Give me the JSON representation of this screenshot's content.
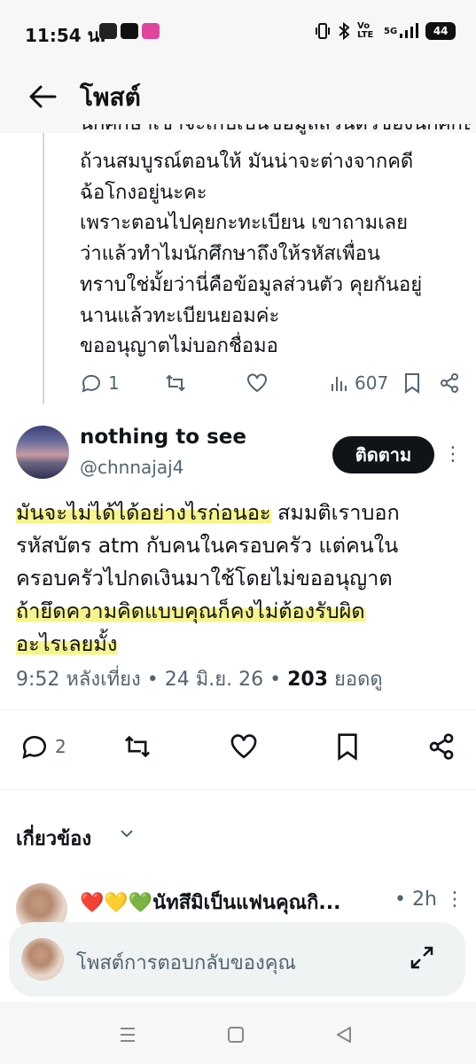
{
  "status_bar": {
    "time": "11:54 น.",
    "network": "5G",
    "volte": "Vo LTE",
    "battery": "44"
  },
  "header": {
    "title": "โพสต์"
  },
  "reply_post": {
    "lines": [
      "นักศึกษาเขาจะเก็บเป็นข้อมูลส่วนตัวของนักศึกษา",
      "ถ้วนสมบูรณ์ตอนให้ มันน่าจะต่างจากคดี",
      "ฉ้อโกงอยู่นะคะ",
      "เพราะตอนไปคุยกะทะเบียน เขาถามเลย",
      "ว่าแล้วทำไมนักศึกษาถึงให้รหัสเพื่อน",
      "ทราบใช่มั้ยว่านี่คือข้อมูลส่วนตัว คุยกันอยู่",
      "นานแล้วทะเบียนยอมค่ะ",
      "ขออนุญาตไม่บอกชื่อมอ"
    ],
    "replies": "1",
    "views": "607"
  },
  "main_post": {
    "author_name": "nothing to see",
    "author_handle": "@chnnajaj4",
    "follow_label": "ติดตาม",
    "text": {
      "l1_hl": "มันจะไม่ได้ได้อย่างไรก่อนอะ",
      "l1_rest": " สมมติเราบอก",
      "l2": "รหัสบัตร atm กับคนในครอบครัว แต่คนใน",
      "l3": "ครอบครัวไปกดเงินมาใช้โดยไม่ขออนุญาต",
      "l4_hl": "ถ้ายึดความคิดแบบคุณก็คงไม่ต้องรับผิด",
      "l5_hl": "อะไรเลยมั้ง"
    },
    "time": "9:52 หลังเที่ยง",
    "sep": " • ",
    "date": "24 มิ.ย. 26",
    "views": "203",
    "views_label": " ยอดดู",
    "replies": "2"
  },
  "related": {
    "title": "เกี่ยวข้อง",
    "item": {
      "name": "❤️💛💚นัทสึมิเป็นแฟนคุณกิ...",
      "time": "• 2h"
    }
  },
  "reply_bar": {
    "placeholder": "โพสต์การตอบกลับของคุณ"
  }
}
